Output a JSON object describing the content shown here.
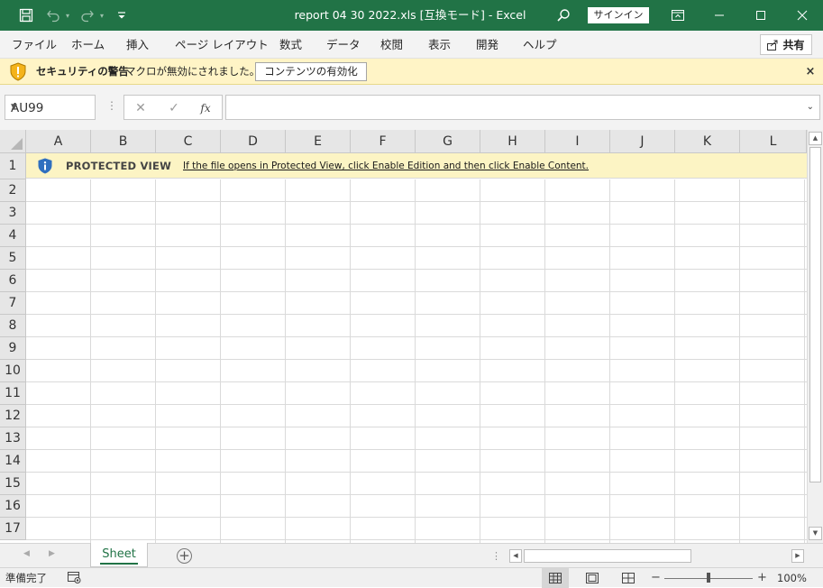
{
  "colors": {
    "brand": "#217346",
    "security_bar": "#fff4c6",
    "protected_banner": "#fcf4c4"
  },
  "titlebar": {
    "title": "report 04 30 2022.xls  [互換モード]  -  Excel",
    "signin_label": "サインイン",
    "icons": [
      "save-icon",
      "undo-icon",
      "redo-icon",
      "customize-icon",
      "search-icon",
      "ribbon-display-icon",
      "minimize-icon",
      "maximize-icon",
      "close-icon"
    ]
  },
  "ribbon": {
    "tabs": [
      "ファイル",
      "ホーム",
      "挿入",
      "ページ レイアウト",
      "数式",
      "データ",
      "校閲",
      "表示",
      "開発",
      "ヘルプ"
    ],
    "share_label": "共有"
  },
  "security_bar": {
    "title": "セキュリティの警告",
    "message": "マクロが無効にされました。",
    "enable_button": "コンテンツの有効化",
    "close": "×"
  },
  "formula_bar": {
    "name_box": "AU99",
    "function_symbol": "fx",
    "formula": ""
  },
  "grid": {
    "columns": [
      "A",
      "B",
      "C",
      "D",
      "E",
      "F",
      "G",
      "H",
      "I",
      "J",
      "K",
      "L"
    ],
    "rows": [
      "1",
      "2",
      "3",
      "4",
      "5",
      "6",
      "7",
      "8",
      "9",
      "10",
      "11",
      "12",
      "13",
      "14",
      "15",
      "16",
      "17"
    ],
    "banner": {
      "title": "PROTECTED VIEW",
      "link": "If the file opens in Protected View, click Enable Edition and then click Enable Content."
    }
  },
  "sheets": {
    "tabs": [
      "Sheet"
    ],
    "active": "Sheet"
  },
  "status": {
    "ready": "準備完了",
    "zoom": "100%",
    "zoom_minus": "−",
    "zoom_plus": "+"
  }
}
